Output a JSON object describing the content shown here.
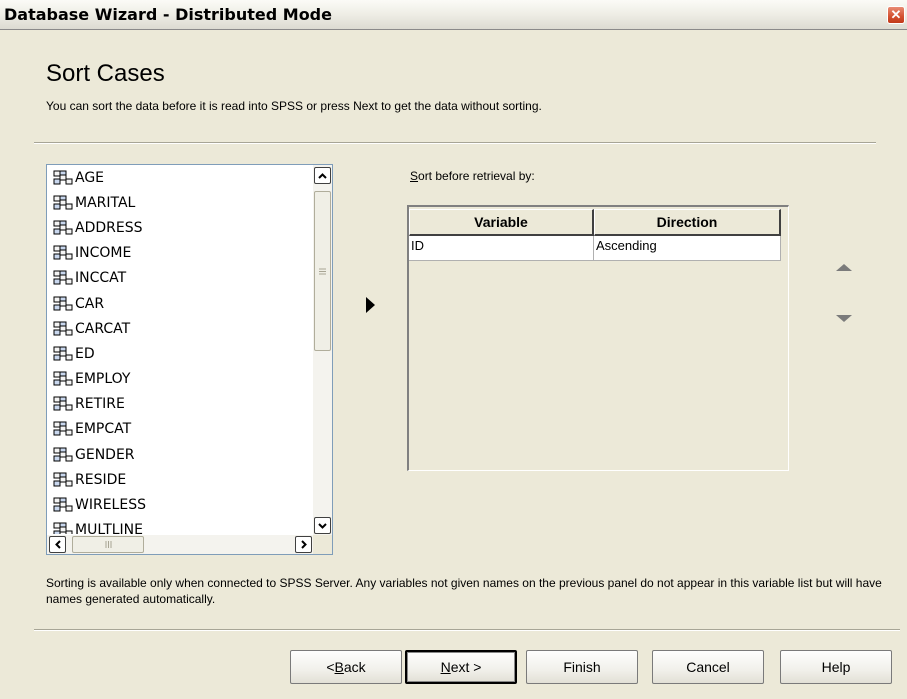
{
  "window": {
    "title": "Database Wizard - Distributed Mode",
    "close_icon": "close-icon"
  },
  "page": {
    "heading": "Sort Cases",
    "subheading": "You can sort the data before it is read into SPSS or press Next to get the data without sorting."
  },
  "variables": {
    "icon": "nominal-variable-icon",
    "items": [
      "AGE",
      "MARITAL",
      "ADDRESS",
      "INCOME",
      "INCCAT",
      "CAR",
      "CARCAT",
      "ED",
      "EMPLOY",
      "RETIRE",
      "EMPCAT",
      "GENDER",
      "RESIDE",
      "WIRELESS",
      "MULTLINE"
    ]
  },
  "sort": {
    "label_prefix": "",
    "label_accel": "S",
    "label_rest": "ort before retrieval by:",
    "columns": [
      "Variable",
      "Direction"
    ],
    "rows": [
      {
        "variable": "ID",
        "direction": "Ascending"
      }
    ]
  },
  "note": "Sorting is available only when connected to SPSS Server. Any variables not given names on the previous panel do not appear in this variable list but will have names generated automatically.",
  "buttons": {
    "back": {
      "pre": "< ",
      "accel": "B",
      "post": "ack"
    },
    "next": {
      "pre": "",
      "accel": "N",
      "post": "ext >"
    },
    "finish": "Finish",
    "cancel": "Cancel",
    "help": "Help"
  },
  "colors": {
    "window_bg": "#ece9d8",
    "list_border": "#7f9db9",
    "close_red": "#d3502f"
  }
}
